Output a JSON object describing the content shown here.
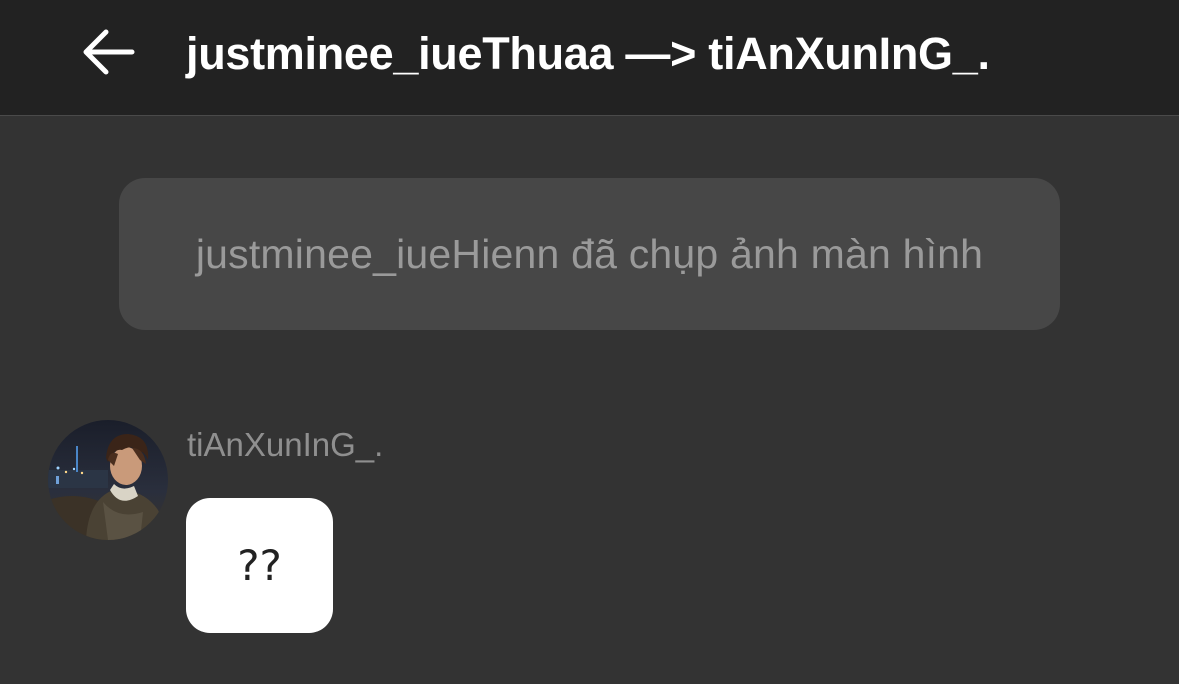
{
  "header": {
    "back_icon": "arrow-left-icon",
    "title": "justminee_iueThuaa —> tiAnXunInG_."
  },
  "chat": {
    "system_notice": "justminee_iueHienn đã chụp ảnh màn hình",
    "messages": [
      {
        "sender": "tiAnXunInG_.",
        "avatar": "user-avatar-photo",
        "text": "??"
      }
    ]
  },
  "colors": {
    "header_bg": "#222222",
    "chat_bg": "#333333",
    "notice_bg": "#474747",
    "notice_text": "#9a9a9a",
    "bubble_bg": "#ffffff"
  }
}
